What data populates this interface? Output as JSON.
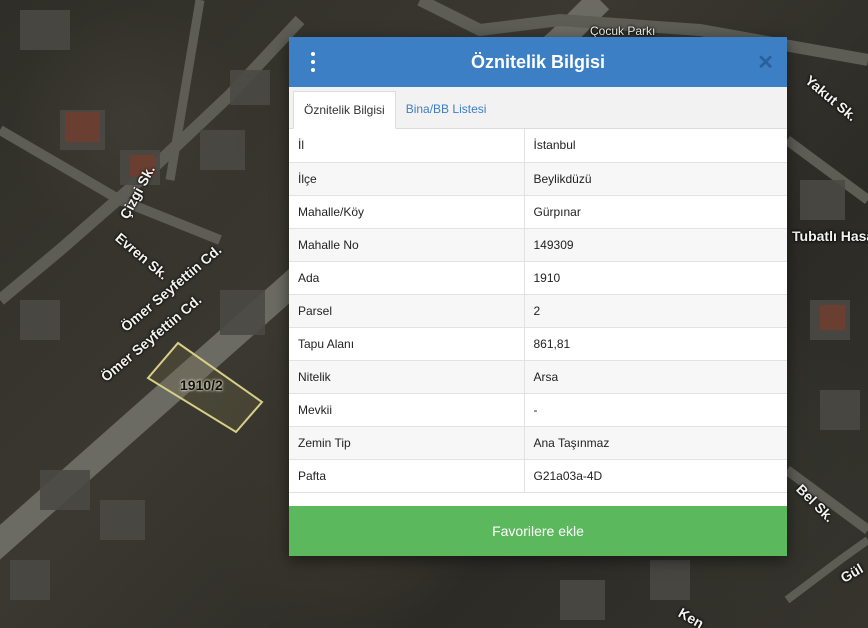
{
  "map": {
    "streets": [
      "Çizgi Sk.",
      "Evren Sk.",
      "Ömer Seyfettin Cd.",
      "Ömer Seyfettin Cd.",
      "Yakut Sk.",
      "Çocuk Parkı",
      "Tubatlı Hasan",
      "Bel Sk.",
      "Gül",
      "Ken"
    ],
    "parcel_label": "1910/2"
  },
  "dialog": {
    "title": "Öznitelik Bilgisi",
    "close_glyph": "✕",
    "tabs": [
      {
        "label": "Öznitelik Bilgisi",
        "active": true
      },
      {
        "label": "Bina/BB Listesi",
        "active": false
      }
    ],
    "rows": [
      {
        "key": "İl",
        "value": "İstanbul"
      },
      {
        "key": "İlçe",
        "value": "Beylikdüzü"
      },
      {
        "key": "Mahalle/Köy",
        "value": "Gürpınar"
      },
      {
        "key": "Mahalle No",
        "value": "149309"
      },
      {
        "key": "Ada",
        "value": "1910"
      },
      {
        "key": "Parsel",
        "value": "2"
      },
      {
        "key": "Tapu Alanı",
        "value": "861,81"
      },
      {
        "key": "Nitelik",
        "value": "Arsa"
      },
      {
        "key": "Mevkii",
        "value": "-"
      },
      {
        "key": "Zemin Tip",
        "value": "Ana Taşınmaz"
      },
      {
        "key": "Pafta",
        "value": "G21a03a-4D"
      }
    ],
    "favorite_button": "Favorilere ekle"
  },
  "colors": {
    "header": "#3d7fc5",
    "favorite": "#5cb85c"
  }
}
